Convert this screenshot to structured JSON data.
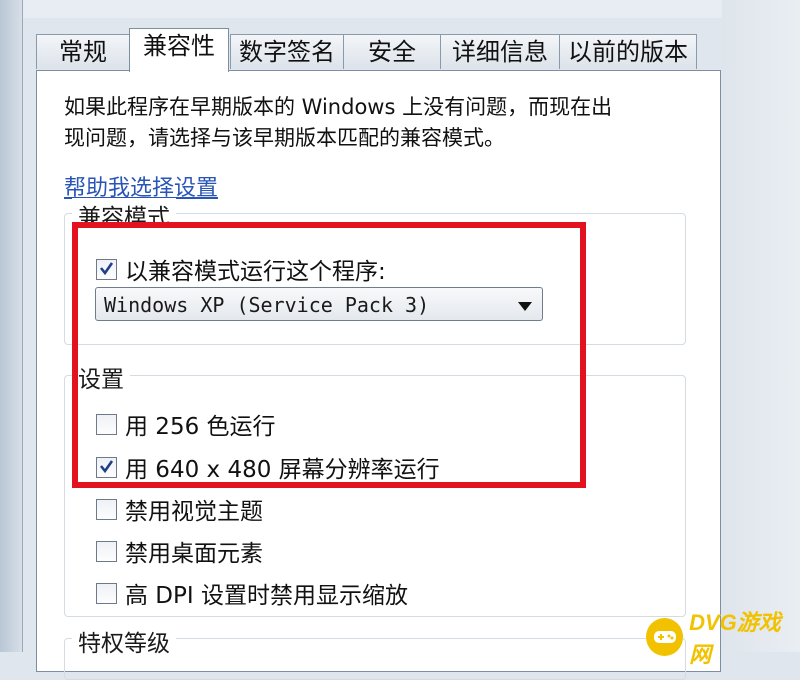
{
  "tabs": [
    {
      "label": "常规",
      "active": false
    },
    {
      "label": "兼容性",
      "active": true
    },
    {
      "label": "数字签名",
      "active": false
    },
    {
      "label": "安全",
      "active": false
    },
    {
      "label": "详细信息",
      "active": false
    },
    {
      "label": "以前的版本",
      "active": false
    }
  ],
  "description": "如果此程序在早期版本的 Windows 上没有问题，而现在出\n现问题，请选择与该早期版本匹配的兼容模式。",
  "help_link": "帮助我选择设置",
  "compat_mode": {
    "title": "兼容模式",
    "run_in_compat": {
      "label": "以兼容模式运行这个程序:",
      "checked": true
    },
    "selected_os": "Windows XP (Service Pack 3)"
  },
  "settings": {
    "title": "设置",
    "options": [
      {
        "label": "用 256 色运行",
        "checked": false
      },
      {
        "label": "用 640 x 480 屏幕分辨率运行",
        "checked": true
      },
      {
        "label": "禁用视觉主题",
        "checked": false
      },
      {
        "label": "禁用桌面元素",
        "checked": false
      },
      {
        "label": "高 DPI 设置时禁用显示缩放",
        "checked": false
      }
    ]
  },
  "privilege": {
    "title": "特权等级"
  },
  "watermark": {
    "text": "DVG游戏网"
  },
  "colors": {
    "highlight": "#e2121e",
    "link": "#2a55b8",
    "watermark": "#f2c200"
  }
}
